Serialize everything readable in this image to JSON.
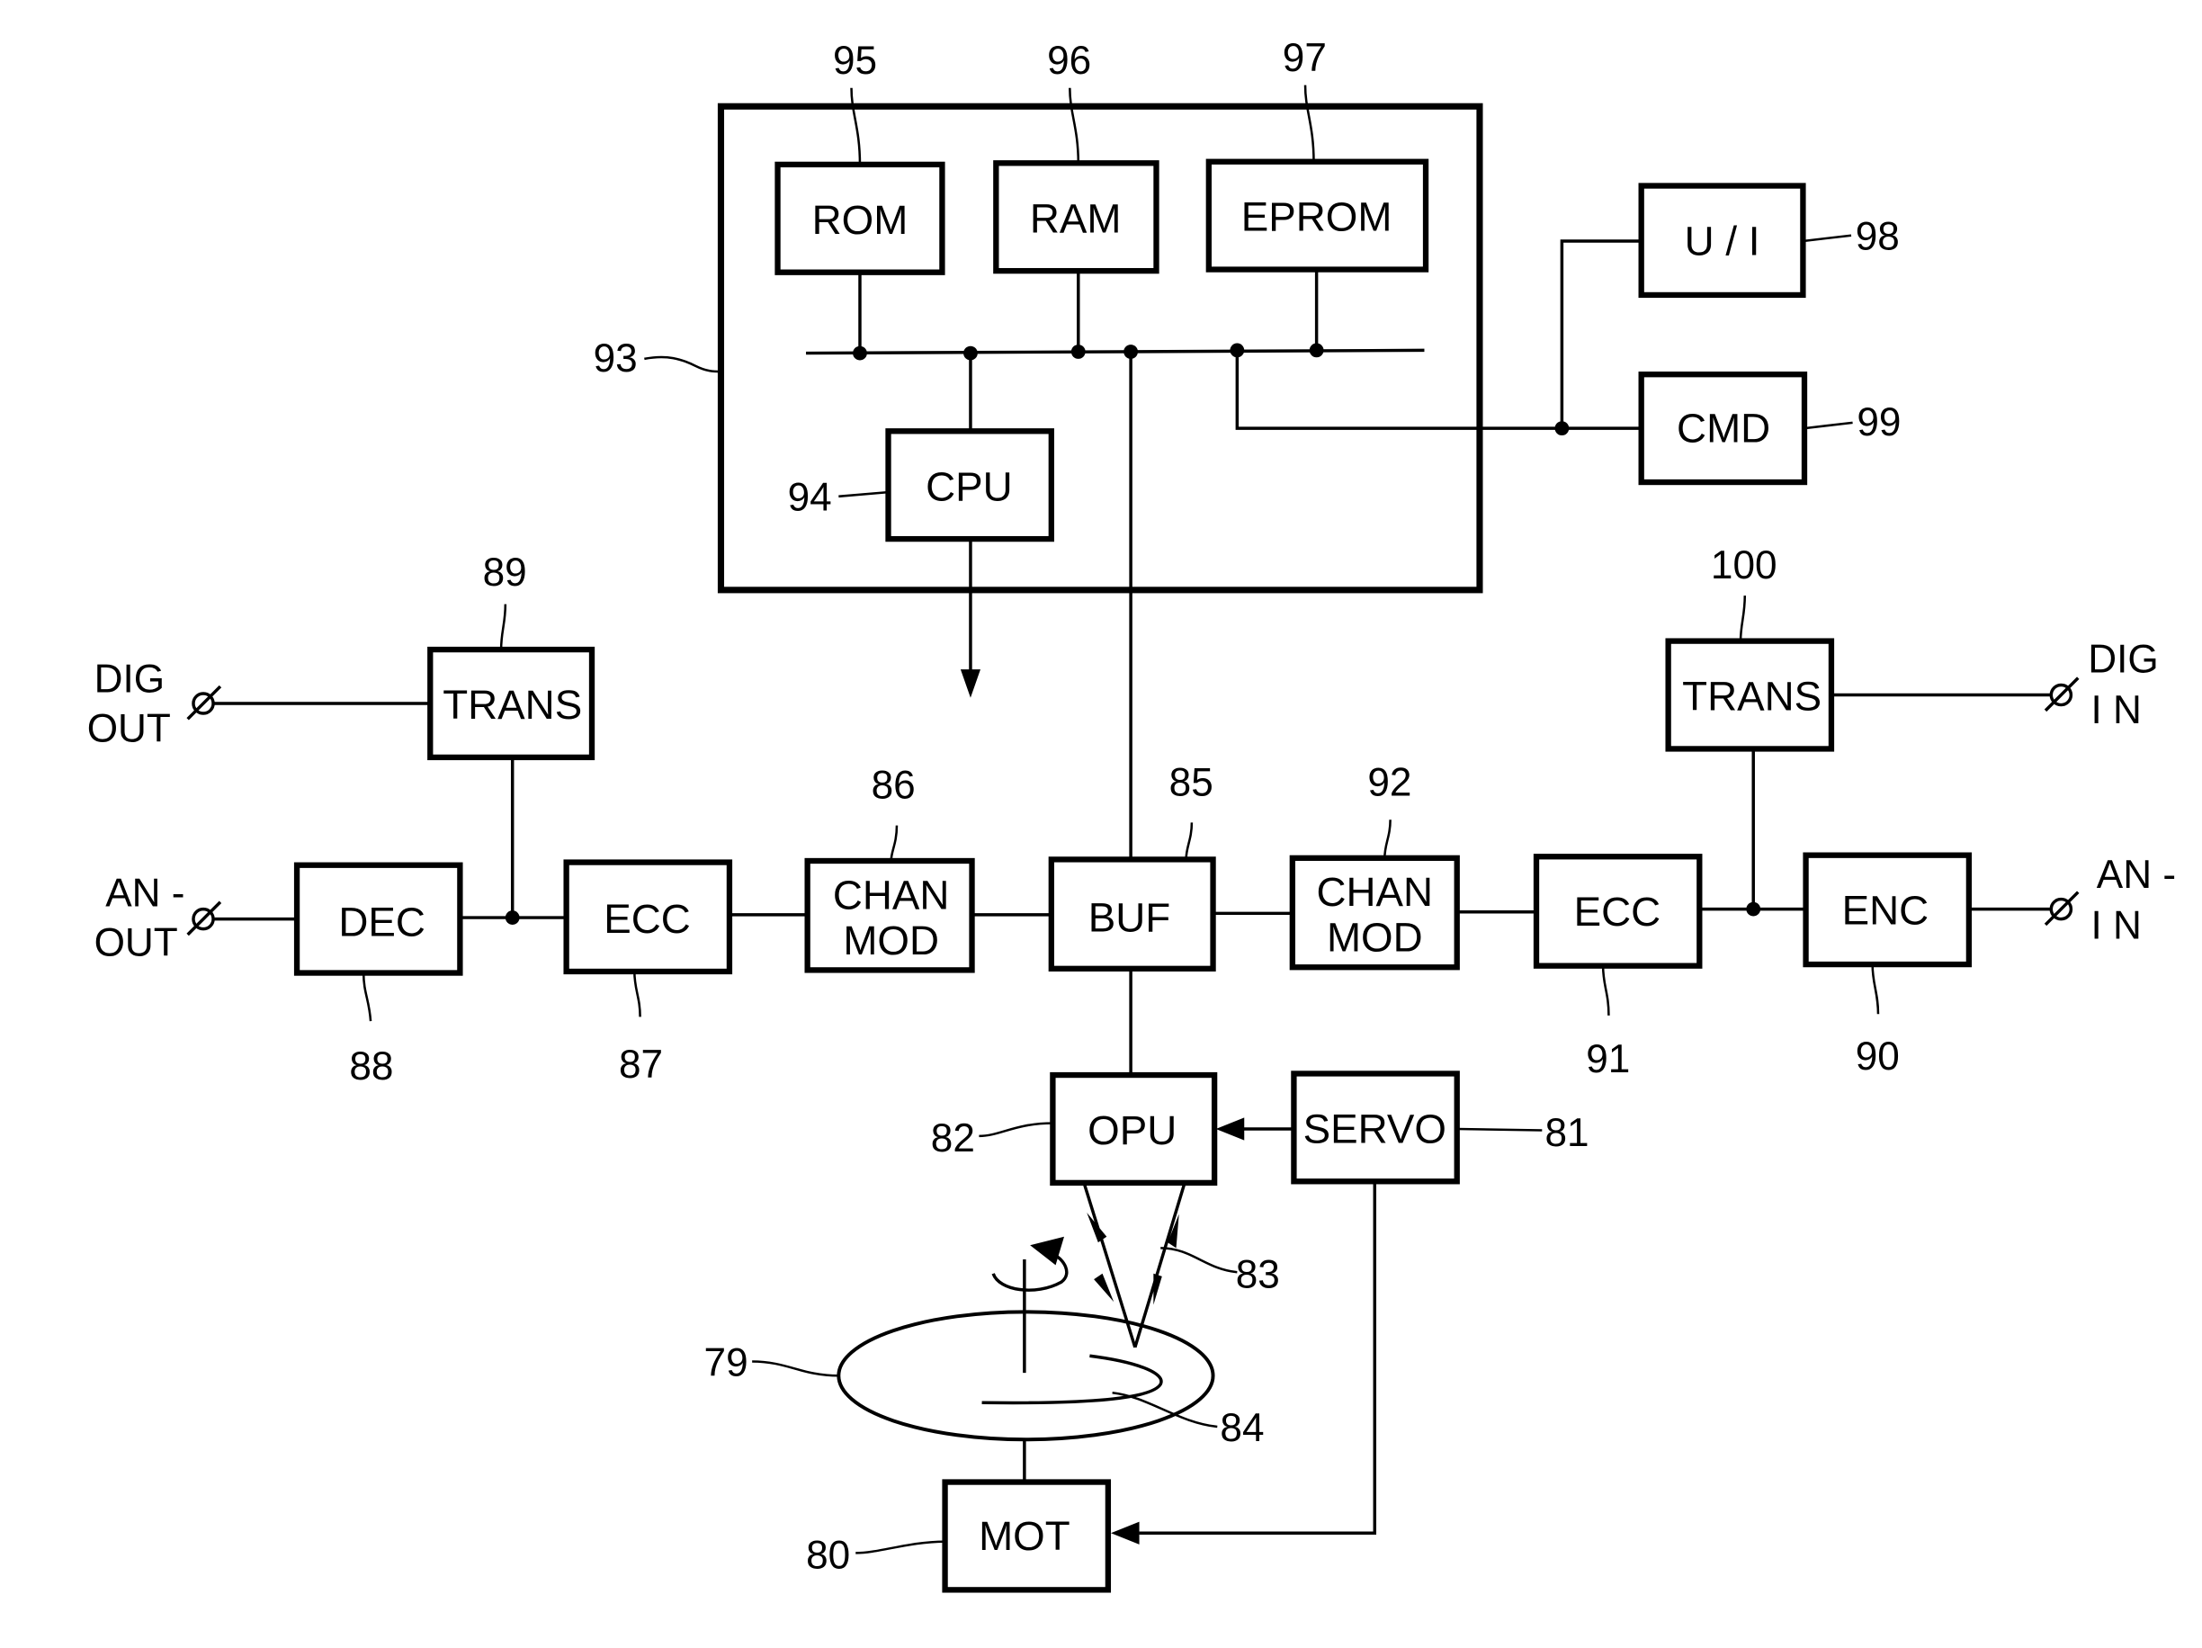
{
  "diagram": {
    "type": "block diagram",
    "subject": "optical disc recording/playback apparatus",
    "blocks": {
      "rom": {
        "label": "ROM",
        "ref": "95"
      },
      "ram": {
        "label": "RAM",
        "ref": "96"
      },
      "eprom": {
        "label": "EPROM",
        "ref": "97"
      },
      "cpu": {
        "label": "CPU",
        "ref": "94"
      },
      "controller": {
        "label": "",
        "ref": "93"
      },
      "ui": {
        "label": "U / I",
        "ref": "98"
      },
      "cmd": {
        "label": "CMD",
        "ref": "99"
      },
      "trans_out": {
        "label": "TRANS",
        "ref": "89"
      },
      "dec": {
        "label": "DEC",
        "ref": "88"
      },
      "ecc_out": {
        "label": "ECC",
        "ref": "87"
      },
      "chanmod_out": {
        "line1": "CHAN",
        "line2": "MOD",
        "ref": "86"
      },
      "buf": {
        "label": "BUF",
        "ref": "85"
      },
      "chanmod_in": {
        "line1": "CHAN",
        "line2": "MOD",
        "ref": "92"
      },
      "ecc_in": {
        "label": "ECC",
        "ref": "91"
      },
      "enc": {
        "label": "ENC",
        "ref": "90"
      },
      "trans_in": {
        "label": "TRANS",
        "ref": "100"
      },
      "opu": {
        "label": "OPU",
        "ref": "82"
      },
      "servo": {
        "label": "SERVO",
        "ref": "81"
      },
      "mot": {
        "label": "MOT",
        "ref": "80"
      },
      "disc": {
        "label": "",
        "ref": "79"
      },
      "beam": {
        "ref": "83"
      },
      "track": {
        "ref": "84"
      }
    },
    "terminals": {
      "dig_out": {
        "line1": "DIG",
        "line2": "OUT"
      },
      "an_out": {
        "line1": "AN -",
        "line2": "OUT"
      },
      "dig_in": {
        "line1": "DIG",
        "line2": "I N"
      },
      "an_in": {
        "line1": "AN -",
        "line2": "I N"
      }
    },
    "terminal_symbol": "Ø"
  }
}
